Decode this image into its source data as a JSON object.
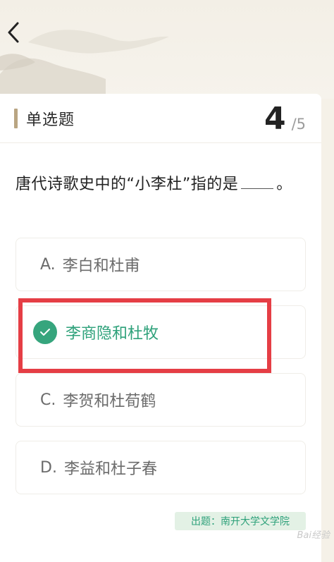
{
  "header": {
    "back_icon": "chevron-left-icon"
  },
  "card": {
    "type_label": "单选题",
    "progress_current": "4",
    "progress_total": "/5",
    "question_before": "唐代诗歌史中的“小李杜”指的是",
    "question_after": "。",
    "options": [
      {
        "letter": "A.",
        "text": "李白和杜甫",
        "state": "normal"
      },
      {
        "letter": "",
        "text": "李商隐和杜牧",
        "state": "correct"
      },
      {
        "letter": "C.",
        "text": "李贺和杜荀鹤",
        "state": "normal"
      },
      {
        "letter": "D.",
        "text": "李益和杜子春",
        "state": "normal"
      }
    ],
    "source": "出题：南开大学文学院"
  },
  "watermark": "Bai经验",
  "colors": {
    "accent_green": "#2ea17a",
    "highlight_red": "#e53e45",
    "tag_bar": "#b9a582"
  }
}
